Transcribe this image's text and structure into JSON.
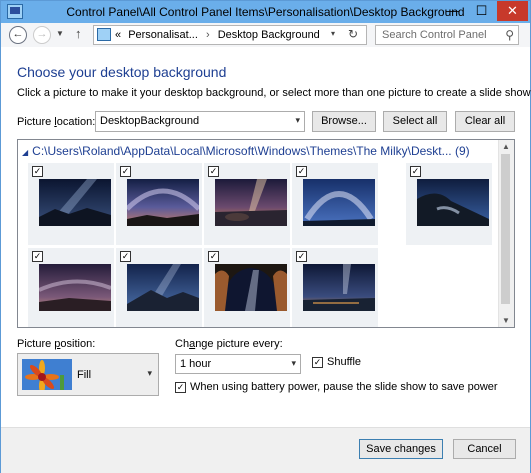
{
  "window": {
    "title": "Control Panel\\All Control Panel Items\\Personalisation\\Desktop Background",
    "minimize_glyph": "—",
    "maximize_glyph": "☐",
    "close_glyph": "✕"
  },
  "nav": {
    "back_glyph": "←",
    "forward_glyph": "→",
    "recent_glyph": "▼",
    "up_glyph": "↑",
    "breadcrumb_prefix": "«",
    "breadcrumb": [
      "Personalisat...",
      "Desktop Background"
    ],
    "breadcrumb_separator": "›",
    "address_dropdown_glyph": "▾",
    "refresh_glyph": "↻",
    "search_placeholder": "Search Control Panel",
    "search_glyph": "⚲"
  },
  "page": {
    "heading": "Choose your desktop background",
    "description": "Click a picture to make it your desktop background, or select more than one picture to create a slide show."
  },
  "picture_location": {
    "label_before": "Picture ",
    "label_accel": "l",
    "label_after": "ocation:",
    "value": "DesktopBackground",
    "dropdown_glyph": "▾",
    "browse_label": "Browse...",
    "select_all_label": "Select all",
    "clear_all_label": "Clear all"
  },
  "gallery": {
    "collapse_glyph": "◢",
    "folder_path": "C:\\Users\\Roland\\AppData\\Local\\Microsoft\\Windows\\Themes\\The Milky\\Deskt...",
    "folder_count": "(9)",
    "check_glyph": "✓",
    "scroll_up_glyph": "▲",
    "scroll_down_glyph": "▼",
    "thumbnails": [
      {
        "name": "milky-way-1",
        "checked": true
      },
      {
        "name": "milky-way-2",
        "checked": true
      },
      {
        "name": "milky-way-3",
        "checked": true
      },
      {
        "name": "milky-way-4",
        "checked": true
      },
      {
        "name": "milky-way-5",
        "checked": true
      },
      {
        "name": "milky-way-6",
        "checked": true
      },
      {
        "name": "milky-way-7",
        "checked": true
      },
      {
        "name": "milky-way-8",
        "checked": true
      },
      {
        "name": "milky-way-9",
        "checked": true
      }
    ]
  },
  "picture_position": {
    "label_before": "Picture ",
    "label_accel": "p",
    "label_after": "osition:",
    "value": "Fill",
    "dropdown_glyph": "▾"
  },
  "change_picture": {
    "label_before": "Ch",
    "label_accel": "a",
    "label_after": "nge picture every:",
    "value": "1 hour",
    "dropdown_glyph": "▾"
  },
  "shuffle": {
    "label": "Shuffle",
    "checked": true
  },
  "battery": {
    "label": "When using battery power, pause the slide show to save power",
    "checked": true
  },
  "footer": {
    "save_label": "Save changes",
    "cancel_label": "Cancel"
  },
  "colors": {
    "titlebar": "#6aaeea",
    "heading": "#1e3f92",
    "close_button": "#c7392b"
  }
}
